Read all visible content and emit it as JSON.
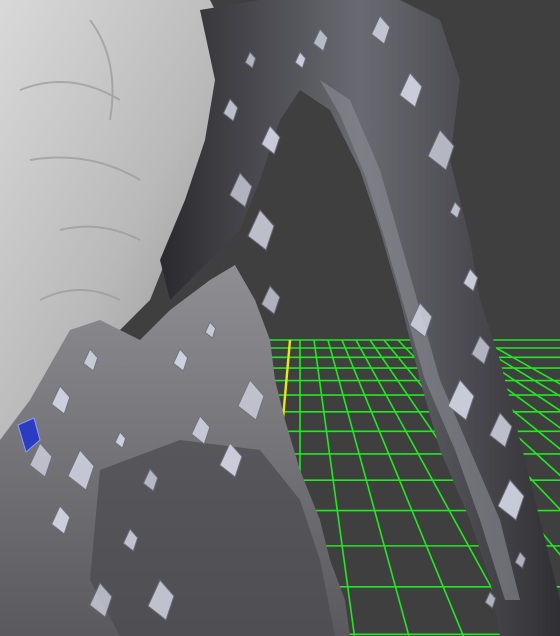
{
  "viewport": {
    "background_color": "#3f3f3f",
    "grid": {
      "visible": true,
      "line_color": "#21e821",
      "axis_color": "#e8e818"
    },
    "model": {
      "surface_color": "#c9c9c9",
      "shadow_color": "#1e1e20",
      "crystal_color": "#d6d8e6",
      "accent_color": "#2a3cc0"
    }
  }
}
